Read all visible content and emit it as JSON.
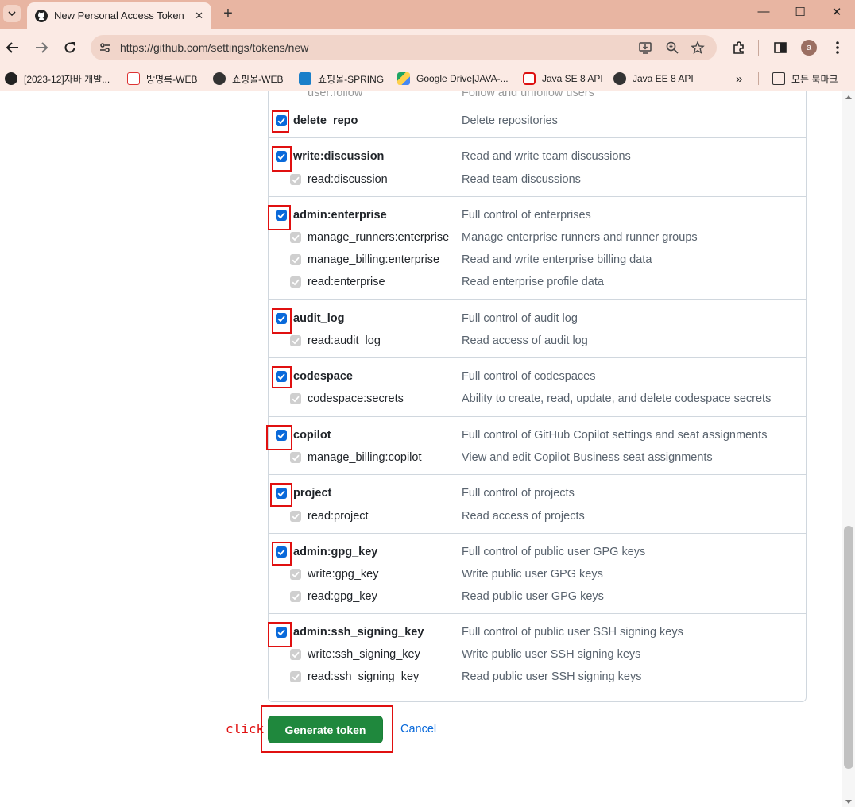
{
  "browser": {
    "tab_title": "New Personal Access Token (C",
    "url": "https://github.com/settings/tokens/new",
    "profile_initial": "a",
    "bookmarks": [
      "[2023-12]자바 개발...",
      "방명록-WEB",
      "쇼핑몰-WEB",
      "쇼핑몰-SPRING",
      "Google Drive[JAVA-...",
      "Java SE 8 API",
      "Java EE 8 API"
    ],
    "all_bookmarks": "모든 북마크",
    "more": "»"
  },
  "scopes": {
    "partial_top_name": "user:follow",
    "partial_top_desc": "Follow and unfollow users",
    "groups": [
      {
        "name": "delete_repo",
        "desc": "Delete repositories",
        "subs": []
      },
      {
        "name": "write:discussion",
        "desc": "Read and write team discussions",
        "subs": [
          {
            "name": "read:discussion",
            "desc": "Read team discussions"
          }
        ]
      },
      {
        "name": "admin:enterprise",
        "desc": "Full control of enterprises",
        "subs": [
          {
            "name": "manage_runners:enterprise",
            "desc": "Manage enterprise runners and runner groups"
          },
          {
            "name": "manage_billing:enterprise",
            "desc": "Read and write enterprise billing data"
          },
          {
            "name": "read:enterprise",
            "desc": "Read enterprise profile data"
          }
        ]
      },
      {
        "name": "audit_log",
        "desc": "Full control of audit log",
        "subs": [
          {
            "name": "read:audit_log",
            "desc": "Read access of audit log"
          }
        ]
      },
      {
        "name": "codespace",
        "desc": "Full control of codespaces",
        "subs": [
          {
            "name": "codespace:secrets",
            "desc": "Ability to create, read, update, and delete codespace secrets"
          }
        ]
      },
      {
        "name": "copilot",
        "desc": "Full control of GitHub Copilot settings and seat assignments",
        "subs": [
          {
            "name": "manage_billing:copilot",
            "desc": "View and edit Copilot Business seat assignments"
          }
        ]
      },
      {
        "name": "project",
        "desc": "Full control of projects",
        "subs": [
          {
            "name": "read:project",
            "desc": "Read access of projects"
          }
        ]
      },
      {
        "name": "admin:gpg_key",
        "desc": "Full control of public user GPG keys",
        "subs": [
          {
            "name": "write:gpg_key",
            "desc": "Write public user GPG keys"
          },
          {
            "name": "read:gpg_key",
            "desc": "Read public user GPG keys"
          }
        ]
      },
      {
        "name": "admin:ssh_signing_key",
        "desc": "Full control of public user SSH signing keys",
        "subs": [
          {
            "name": "write:ssh_signing_key",
            "desc": "Write public user SSH signing keys"
          },
          {
            "name": "read:ssh_signing_key",
            "desc": "Read public user SSH signing keys"
          }
        ]
      }
    ]
  },
  "actions": {
    "annotation": "click",
    "generate_label": "Generate token",
    "cancel_label": "Cancel"
  },
  "colors": {
    "primary_button": "#1f883d",
    "link": "#0969da",
    "checkbox_checked": "#0969da",
    "highlight": "#e01010"
  }
}
